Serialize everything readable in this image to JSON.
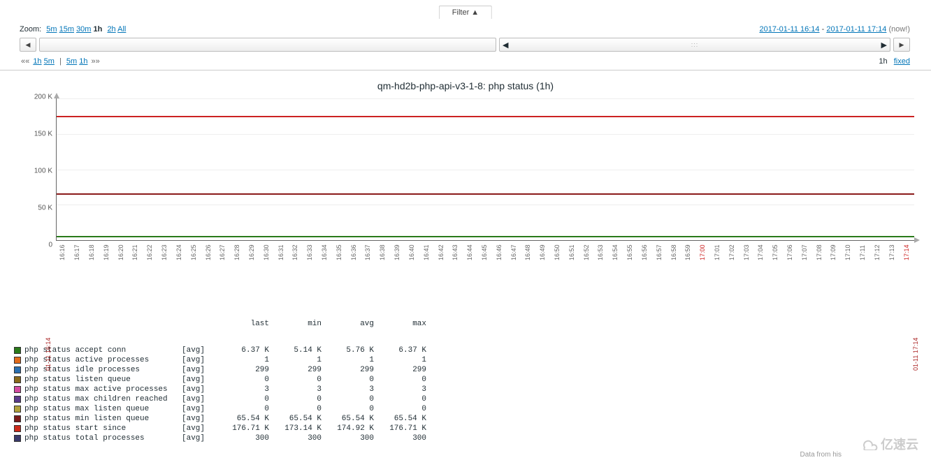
{
  "filter_label": "Filter ▲",
  "zoom": {
    "label": "Zoom:",
    "options": [
      "5m",
      "15m",
      "30m",
      "1h",
      "2h",
      "All"
    ],
    "selected": "1h"
  },
  "timerange": {
    "start": "2017-01-11 16:14",
    "end": "2017-01-11 17:14",
    "now_suffix": "(now!)"
  },
  "nav_back": {
    "prefix": "««",
    "items_left": [
      "1h",
      "5m"
    ],
    "items_right": [
      "5m",
      "1h"
    ],
    "suffix": "»»"
  },
  "nav_right": {
    "label_1h": "1h",
    "label_fixed": "fixed"
  },
  "chart_title": "qm-hd2b-php-api-v3-1-8: php status (1h)",
  "legend_headers": [
    "last",
    "min",
    "avg",
    "max"
  ],
  "legend": [
    {
      "color": "#2a7a1a",
      "name": "php status accept conn",
      "agg": "[avg]",
      "last": "6.37 K",
      "min": "5.14 K",
      "avg": "5.76 K",
      "max": "6.37 K"
    },
    {
      "color": "#e06a1a",
      "name": "php status active processes",
      "agg": "[avg]",
      "last": "1",
      "min": "1",
      "avg": "1",
      "max": "1"
    },
    {
      "color": "#2a6fb0",
      "name": "php status idle processes",
      "agg": "[avg]",
      "last": "299",
      "min": "299",
      "avg": "299",
      "max": "299"
    },
    {
      "color": "#8a6a1a",
      "name": "php status listen queue",
      "agg": "[avg]",
      "last": "0",
      "min": "0",
      "avg": "0",
      "max": "0"
    },
    {
      "color": "#d24aa0",
      "name": "php status max active processes",
      "agg": "[avg]",
      "last": "3",
      "min": "3",
      "avg": "3",
      "max": "3"
    },
    {
      "color": "#5a3a8a",
      "name": "php status max children reached",
      "agg": "[avg]",
      "last": "0",
      "min": "0",
      "avg": "0",
      "max": "0"
    },
    {
      "color": "#b0a03a",
      "name": "php status max listen queue",
      "agg": "[avg]",
      "last": "0",
      "min": "0",
      "avg": "0",
      "max": "0"
    },
    {
      "color": "#7a1a1a",
      "name": "php status min listen queue",
      "agg": "[avg]",
      "last": "65.54 K",
      "min": "65.54 K",
      "avg": "65.54 K",
      "max": "65.54 K"
    },
    {
      "color": "#cc2a1a",
      "name": "php status start since",
      "agg": "[avg]",
      "last": "176.71 K",
      "min": "173.14 K",
      "avg": "174.92 K",
      "max": "176.71 K"
    },
    {
      "color": "#3a3a6a",
      "name": "php status total processes",
      "agg": "[avg]",
      "last": "300",
      "min": "300",
      "avg": "300",
      "max": "300"
    }
  ],
  "chart_data": {
    "type": "line",
    "title": "qm-hd2b-php-api-v3-1-8: php status (1h)",
    "xlabel": "",
    "ylabel": "",
    "ylim": [
      0,
      200000
    ],
    "yticks": [
      0,
      50000,
      100000,
      150000,
      200000
    ],
    "ytick_labels": [
      "0",
      "50 K",
      "100 K",
      "150 K",
      "200 K"
    ],
    "x": [
      "16:16",
      "16:17",
      "16:18",
      "16:19",
      "16:20",
      "16:21",
      "16:22",
      "16:23",
      "16:24",
      "16:25",
      "16:26",
      "16:27",
      "16:28",
      "16:29",
      "16:30",
      "16:31",
      "16:32",
      "16:33",
      "16:34",
      "16:35",
      "16:36",
      "16:37",
      "16:38",
      "16:39",
      "16:40",
      "16:41",
      "16:42",
      "16:43",
      "16:44",
      "16:45",
      "16:46",
      "16:47",
      "16:48",
      "16:49",
      "16:50",
      "16:51",
      "16:52",
      "16:53",
      "16:54",
      "16:55",
      "16:56",
      "16:57",
      "16:58",
      "16:59",
      "17:00",
      "17:01",
      "17:02",
      "17:03",
      "17:04",
      "17:05",
      "17:06",
      "17:07",
      "17:08",
      "17:09",
      "17:10",
      "17:11",
      "17:12",
      "17:13",
      "17:14"
    ],
    "x_range_label_start": "01-11 16:14",
    "x_range_label_end": "01-11 17:14",
    "series": [
      {
        "name": "php status start since",
        "color": "#cc2a1a",
        "approx_constant_value": 175000
      },
      {
        "name": "php status min listen queue",
        "color": "#7a1a1a",
        "approx_constant_value": 65540
      },
      {
        "name": "php status accept conn",
        "color": "#2a7a1a",
        "approx_constant_value": 5760
      },
      {
        "name": "php status total processes",
        "color": "#3a3a6a",
        "approx_constant_value": 300
      },
      {
        "name": "php status idle processes",
        "color": "#2a6fb0",
        "approx_constant_value": 299
      },
      {
        "name": "php status max active processes",
        "color": "#d24aa0",
        "approx_constant_value": 3
      },
      {
        "name": "php status active processes",
        "color": "#e06a1a",
        "approx_constant_value": 1
      },
      {
        "name": "php status listen queue",
        "color": "#8a6a1a",
        "approx_constant_value": 0
      },
      {
        "name": "php status max children reached",
        "color": "#5a3a8a",
        "approx_constant_value": 0
      },
      {
        "name": "php status max listen queue",
        "color": "#b0a03a",
        "approx_constant_value": 0
      }
    ]
  },
  "watermark": "亿速云",
  "footer_hint": "Data from his"
}
